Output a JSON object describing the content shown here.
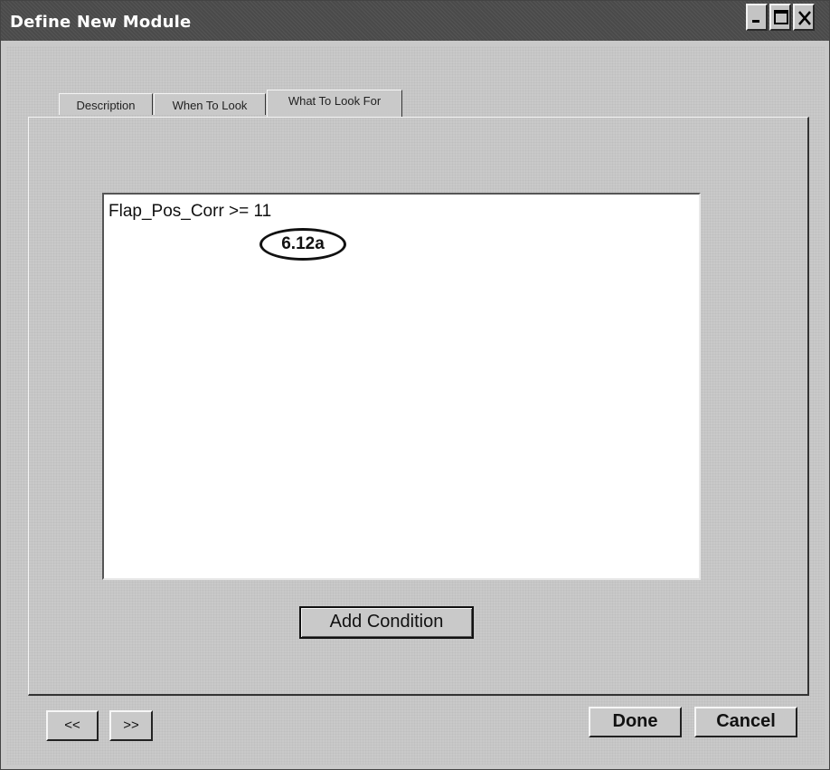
{
  "window": {
    "title": "Define New Module",
    "controls": {
      "minimize": "minimize-icon",
      "maximize": "maximize-icon",
      "close": "close-icon"
    }
  },
  "tabs": [
    {
      "label": "Description",
      "active": false
    },
    {
      "label": "When To Look",
      "active": false
    },
    {
      "label": "What To Look For",
      "active": true
    }
  ],
  "conditions": {
    "items": [
      "Flap_Pos_Corr >= 11"
    ],
    "annotation": "6.12a"
  },
  "buttons": {
    "add_condition": "Add Condition",
    "prev": "<<",
    "next": ">>",
    "done": "Done",
    "cancel": "Cancel"
  }
}
